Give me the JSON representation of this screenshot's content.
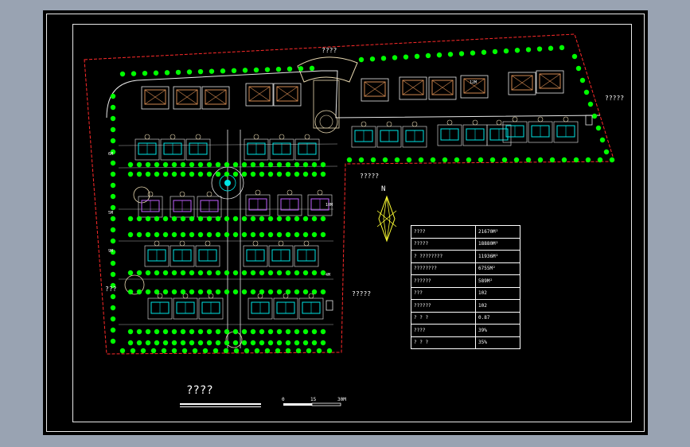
{
  "drawing": {
    "title": "????",
    "north_label": "N",
    "callouts": {
      "top_center": "????",
      "right_edge": "?????",
      "middle_entrance": "?????",
      "left_side": "???",
      "bottom_right": "?????"
    },
    "road_widths": [
      "?M",
      "6M",
      "5M",
      "9M",
      "10M",
      "4M",
      "12M"
    ],
    "colors": {
      "background": "#000000",
      "site_boundary": "#ff2a2a",
      "trees": "#00ff00",
      "villa_roof": "#d08850",
      "villa_outline": "#e8e8e8",
      "townhouse_unit": "#00e5e5",
      "plaza": "#e8d8b0",
      "compass": "#ffff33",
      "purple_units": "#c060ff"
    }
  },
  "stats_table": {
    "rows": [
      {
        "label": "????",
        "value": "21670M²"
      },
      {
        "label": "?????",
        "value": "18880M²"
      },
      {
        "label": "? ????????",
        "value": "11936M²"
      },
      {
        "label": "????????",
        "value": "6755M²"
      },
      {
        "label": "??????",
        "value": "589M²"
      },
      {
        "label": "???",
        "value": "102"
      },
      {
        "label": "??????",
        "value": "102"
      },
      {
        "label": "? ? ?",
        "value": "0.87"
      },
      {
        "label": "????",
        "value": "39%"
      },
      {
        "label": "? ? ?",
        "value": "35%"
      }
    ]
  },
  "scale_bar": {
    "ticks": [
      "0",
      "15",
      "30M"
    ]
  }
}
